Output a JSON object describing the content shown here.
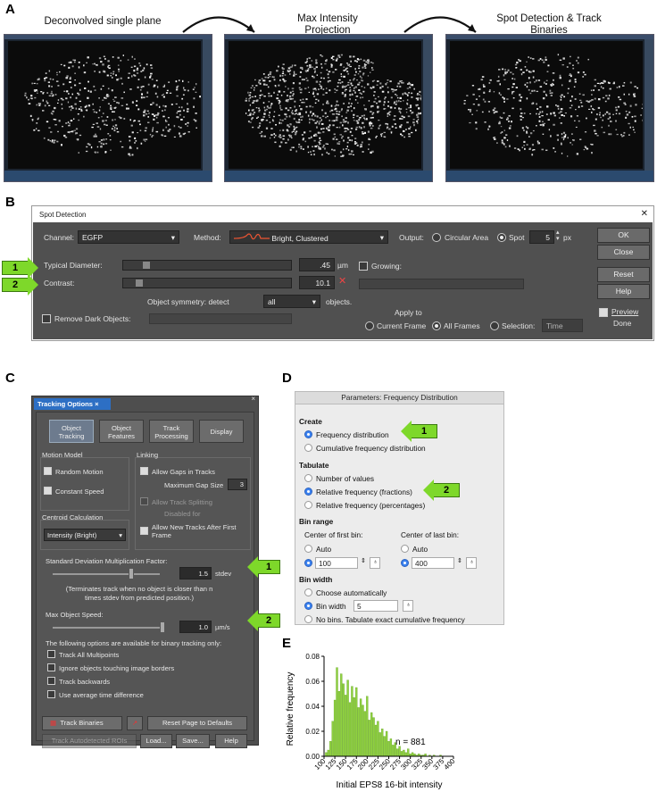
{
  "panelA": {
    "letter": "A",
    "titles": [
      "Deconvolved single plane",
      "Max Intensity Projection",
      "Spot Detection & Track Binaries"
    ]
  },
  "panelB": {
    "letter": "B",
    "title": "Spot Detection",
    "close": "✕",
    "channel_label": "Channel:",
    "channel": "EGFP",
    "method_label": "Method:",
    "method": "Bright, Clustered",
    "output_label": "Output:",
    "out_circ": "Circular Area",
    "out_spot": "Spot",
    "spot_val": "5",
    "spot_unit": "px",
    "typ_label": "Typical Diameter:",
    "typ_val": ".45",
    "typ_unit": "µm",
    "con_label": "Contrast:",
    "con_val": "10.1",
    "sym_label": "Object symmetry: detect",
    "sym_val": "all",
    "sym_unit": "objects.",
    "remove_dark": "Remove Dark Objects:",
    "growing": "Growing:",
    "apply_to": "Apply to",
    "apply_cur": "Current Frame",
    "apply_all": "All Frames",
    "apply_sel": "Selection:",
    "apply_sel_val": "Time",
    "ok": "OK",
    "close_btn": "Close",
    "reset": "Reset",
    "help": "Help",
    "preview": "Preview",
    "done": "Done",
    "arrow1": "1",
    "arrow2": "2"
  },
  "panelC": {
    "letter": "C",
    "tab": "Tracking Options ×",
    "tabs": [
      "Object Tracking",
      "Object Features",
      "Track Processing",
      "Display"
    ],
    "motion_model": "Motion Model",
    "random": "Random Motion",
    "constant": "Constant Speed",
    "linking": "Linking",
    "gaps": "Allow Gaps in Tracks",
    "max_gap": "Maximum Gap Size",
    "max_gap_val": "3",
    "split": "Allow Track Splitting",
    "disabled": "Disabled for",
    "new_tracks": "Allow New Tracks After First Frame",
    "centroid": "Centroid Calculation",
    "centroid_val": "Intensity (Bright)",
    "sd_label": "Standard Deviation Multiplication Factor:",
    "sd_val": "1.5",
    "sd_unit": "stdev",
    "sd_note": "(Terminates track when no object is closer than n times stdev from predicted position.)",
    "speed_label": "Max Object Speed:",
    "speed_val": "1.0",
    "speed_unit": "µm/s",
    "binary_note": "The following options are available for binary tracking only:",
    "opts": [
      "Track All Multipoints",
      "Ignore objects touching image borders",
      "Track backwards",
      "Use average time difference"
    ],
    "track_binaries": "Track Binaries",
    "reset_page": "Reset Page to Defaults",
    "track_auto": "Track Autodetected ROIs",
    "load": "Load...",
    "save": "Save...",
    "help": "Help",
    "arrow1": "1",
    "arrow2": "2"
  },
  "panelD": {
    "letter": "D",
    "title": "Parameters: Frequency Distribution",
    "create": "Create",
    "freq": "Frequency distribution",
    "cum": "Cumulative frequency distribution",
    "tabulate": "Tabulate",
    "num": "Number of values",
    "relf": "Relative frequency (fractions)",
    "relp": "Relative frequency (percentages)",
    "bin_range": "Bin range",
    "first": "Center of first bin:",
    "last": "Center of last bin:",
    "auto": "Auto",
    "first_val": "100",
    "last_val": "400",
    "bin_width": "Bin width",
    "choose": "Choose automatically",
    "bw_label": "Bin width",
    "bw_val": "5",
    "nobins": "No bins. Tabulate exact cumulative frequency",
    "arrow1": "1",
    "arrow2": "2"
  },
  "panelE": {
    "letter": "E",
    "n": "n = 881"
  },
  "chart_data": {
    "type": "bar",
    "xlabel": "Initial EPS8 16-bit intensity",
    "ylabel": "Relative frequency",
    "color": "#8fd13f",
    "xlim": [
      100,
      400
    ],
    "ylim": [
      0,
      0.08
    ],
    "xticks": [
      "100",
      "125",
      "150",
      "175",
      "200",
      "225",
      "250",
      "275",
      "300",
      "325",
      "350",
      "375",
      "400"
    ],
    "yticks": [
      "0.00",
      "0.02",
      "0.04",
      "0.06",
      "0.08"
    ],
    "bin_width": 5,
    "x": [
      105,
      110,
      115,
      120,
      125,
      130,
      135,
      140,
      145,
      150,
      155,
      160,
      165,
      170,
      175,
      180,
      185,
      190,
      195,
      200,
      205,
      210,
      215,
      220,
      225,
      230,
      235,
      240,
      245,
      250,
      255,
      260,
      265,
      270,
      275,
      280,
      285,
      290,
      295,
      300,
      305,
      310,
      315,
      320,
      325,
      330,
      335,
      340,
      345,
      350,
      355,
      360,
      365,
      370,
      375,
      380,
      385,
      390,
      395,
      400
    ],
    "values": [
      0.003,
      0.005,
      0.012,
      0.028,
      0.045,
      0.071,
      0.052,
      0.066,
      0.058,
      0.049,
      0.061,
      0.043,
      0.056,
      0.047,
      0.055,
      0.039,
      0.046,
      0.041,
      0.036,
      0.048,
      0.029,
      0.035,
      0.031,
      0.025,
      0.028,
      0.019,
      0.022,
      0.016,
      0.02,
      0.012,
      0.014,
      0.009,
      0.011,
      0.006,
      0.008,
      0.004,
      0.005,
      0.003,
      0.006,
      0.002,
      0.003,
      0.002,
      0.001,
      0.002,
      0.001,
      0.001,
      0.002,
      0.0,
      0.001,
      0.0,
      0.001,
      0.0,
      0.0,
      0.001,
      0.0,
      0.0,
      0.0,
      0.0,
      0.0,
      0.0
    ]
  }
}
